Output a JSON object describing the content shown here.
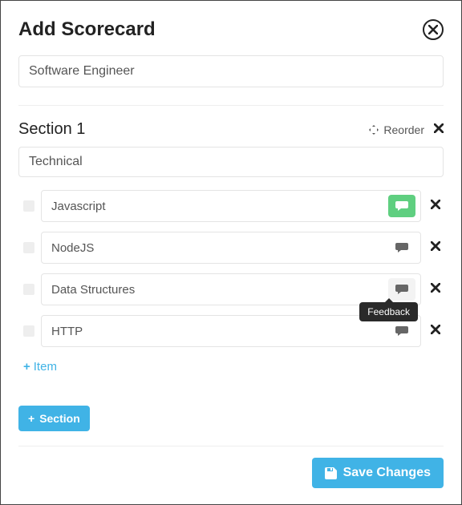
{
  "header": {
    "title": "Add Scorecard"
  },
  "scorecard": {
    "name": "Software Engineer"
  },
  "section": {
    "label": "Section 1",
    "reorder_label": "Reorder",
    "name": "Technical",
    "items": [
      {
        "name": "Javascript",
        "feedback_style": "active"
      },
      {
        "name": "NodeJS",
        "feedback_style": "plain"
      },
      {
        "name": "Data Structures",
        "feedback_style": "inactive",
        "show_tooltip": true
      },
      {
        "name": "HTTP",
        "feedback_style": "plain"
      }
    ],
    "add_item_label": "Item"
  },
  "tooltip": {
    "feedback": "Feedback"
  },
  "actions": {
    "add_section_label": "Section",
    "save_label": "Save Changes"
  },
  "colors": {
    "accent": "#40b3e6",
    "success": "#5fcf80"
  }
}
